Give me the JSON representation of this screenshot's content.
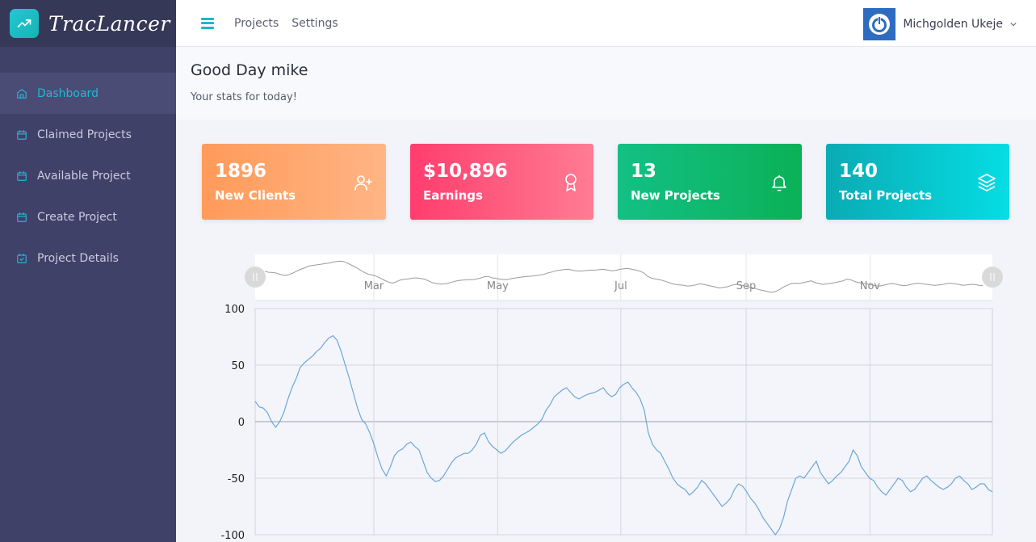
{
  "app": {
    "brand_name": "TracLancer",
    "brand_icon": "trending-up-icon"
  },
  "sidebar": {
    "items": [
      {
        "label": "Dashboard",
        "icon": "home-icon",
        "active": true
      },
      {
        "label": "Claimed Projects",
        "icon": "calendar-icon",
        "active": false
      },
      {
        "label": "Available Project",
        "icon": "calendar-icon",
        "active": false
      },
      {
        "label": "Create Project",
        "icon": "calendar-icon",
        "active": false
      },
      {
        "label": "Project Details",
        "icon": "calendar-check-icon",
        "active": false
      }
    ]
  },
  "topbar": {
    "links": [
      "Projects",
      "Settings"
    ],
    "user_name": "Michgolden Ukeje",
    "menu_icon": "hamburger-icon",
    "caret_icon": "chevron-down-icon",
    "avatar_icon": "power-icon"
  },
  "greeting": {
    "title": "Good Day mike",
    "subtitle": "Your stats for today!"
  },
  "cards": [
    {
      "value": "1896",
      "label": "New Clients",
      "icon": "user-plus-icon",
      "colors": [
        "#ff9a5a",
        "#ffb584"
      ]
    },
    {
      "value": "$10,896",
      "label": "Earnings",
      "icon": "award-icon",
      "colors": [
        "#ff3d6e",
        "#ff7c93"
      ]
    },
    {
      "value": "13",
      "label": "New Projects",
      "icon": "bell-icon",
      "colors": [
        "#13c085",
        "#0bb157"
      ]
    },
    {
      "value": "140",
      "label": "Total Projects",
      "icon": "layers-icon",
      "colors": [
        "#0aabb4",
        "#06dde3"
      ]
    }
  ],
  "chart_data": {
    "type": "line",
    "x_ticks": [
      "Mar",
      "May",
      "Jul",
      "Sep",
      "Nov"
    ],
    "y_ticks": [
      "100",
      "50",
      "0",
      "-50",
      "-100"
    ],
    "ylim": [
      -100,
      100
    ],
    "line_color": "#6ba7d9",
    "grid": true,
    "range_navigator": true,
    "series": [
      {
        "x": [
          0,
          2,
          4,
          6,
          8,
          10,
          12,
          14,
          16,
          18,
          20,
          22,
          24,
          26,
          28,
          30,
          32,
          34,
          36,
          38,
          40,
          42,
          44,
          46,
          48,
          50,
          52,
          54,
          56,
          58,
          60,
          62,
          64,
          66,
          68,
          70,
          72,
          74,
          76,
          78,
          80,
          82,
          84,
          86,
          88,
          90,
          92,
          94,
          96,
          98,
          100,
          102,
          104,
          106,
          108,
          110,
          112,
          114,
          116,
          118,
          120,
          122,
          124,
          126,
          128,
          130,
          132,
          134,
          136,
          138,
          140,
          142,
          144,
          146,
          148,
          150,
          152,
          154,
          156,
          158,
          160,
          162,
          164,
          166,
          168,
          170,
          172,
          174,
          176,
          178,
          180,
          182,
          184,
          186,
          188,
          190,
          192,
          194,
          196,
          198,
          200,
          202,
          204,
          206,
          208,
          210,
          212,
          214,
          216,
          218,
          220,
          222,
          224,
          226,
          228,
          230,
          232,
          234,
          236,
          238,
          240,
          242,
          244,
          246,
          248,
          250,
          252,
          254,
          256,
          258,
          260,
          262,
          264,
          266,
          268,
          270,
          272,
          274,
          276,
          278,
          280,
          282,
          284,
          286,
          288,
          290,
          292,
          294,
          296,
          298,
          300,
          302,
          304,
          306,
          308,
          310,
          312,
          314,
          316,
          318,
          320,
          322,
          324,
          326,
          328,
          330,
          332,
          334,
          336,
          338,
          340,
          342,
          344,
          346,
          348,
          350,
          352,
          354,
          356,
          358,
          360
        ],
        "values": [
          18,
          13,
          12,
          8,
          0,
          -5,
          0,
          8,
          20,
          30,
          38,
          48,
          52,
          55,
          58,
          62,
          65,
          70,
          74,
          76,
          72,
          62,
          50,
          38,
          25,
          12,
          2,
          -2,
          -10,
          -20,
          -32,
          -42,
          -48,
          -40,
          -30,
          -26,
          -24,
          -20,
          -18,
          -22,
          -25,
          -35,
          -45,
          -50,
          -53,
          -52,
          -48,
          -42,
          -36,
          -32,
          -30,
          -28,
          -28,
          -25,
          -20,
          -12,
          -10,
          -18,
          -22,
          -25,
          -28,
          -26,
          -22,
          -18,
          -15,
          -12,
          -10,
          -8,
          -5,
          -2,
          2,
          10,
          15,
          22,
          25,
          28,
          30,
          26,
          22,
          20,
          22,
          24,
          25,
          26,
          28,
          30,
          25,
          22,
          24,
          30,
          33,
          35,
          30,
          26,
          20,
          10,
          -10,
          -20,
          -25,
          -28,
          -35,
          -42,
          -50,
          -55,
          -58,
          -60,
          -65,
          -62,
          -58,
          -52,
          -55,
          -60,
          -65,
          -70,
          -75,
          -72,
          -68,
          -60,
          -55,
          -57,
          -62,
          -68,
          -72,
          -78,
          -85,
          -90,
          -95,
          -100,
          -95,
          -85,
          -70,
          -60,
          -50,
          -48,
          -50,
          -45,
          -40,
          -35,
          -45,
          -50,
          -55,
          -52,
          -48,
          -45,
          -40,
          -35,
          -25,
          -30,
          -40,
          -45,
          -50,
          -52,
          -58,
          -62,
          -65,
          -60,
          -55,
          -50,
          -52,
          -58,
          -62,
          -60,
          -55,
          -50,
          -48,
          -52,
          -55,
          -58,
          -60,
          -58,
          -55,
          -50,
          -48,
          -52,
          -55,
          -60,
          -58,
          -55,
          -55,
          -60,
          -62
        ]
      }
    ]
  }
}
